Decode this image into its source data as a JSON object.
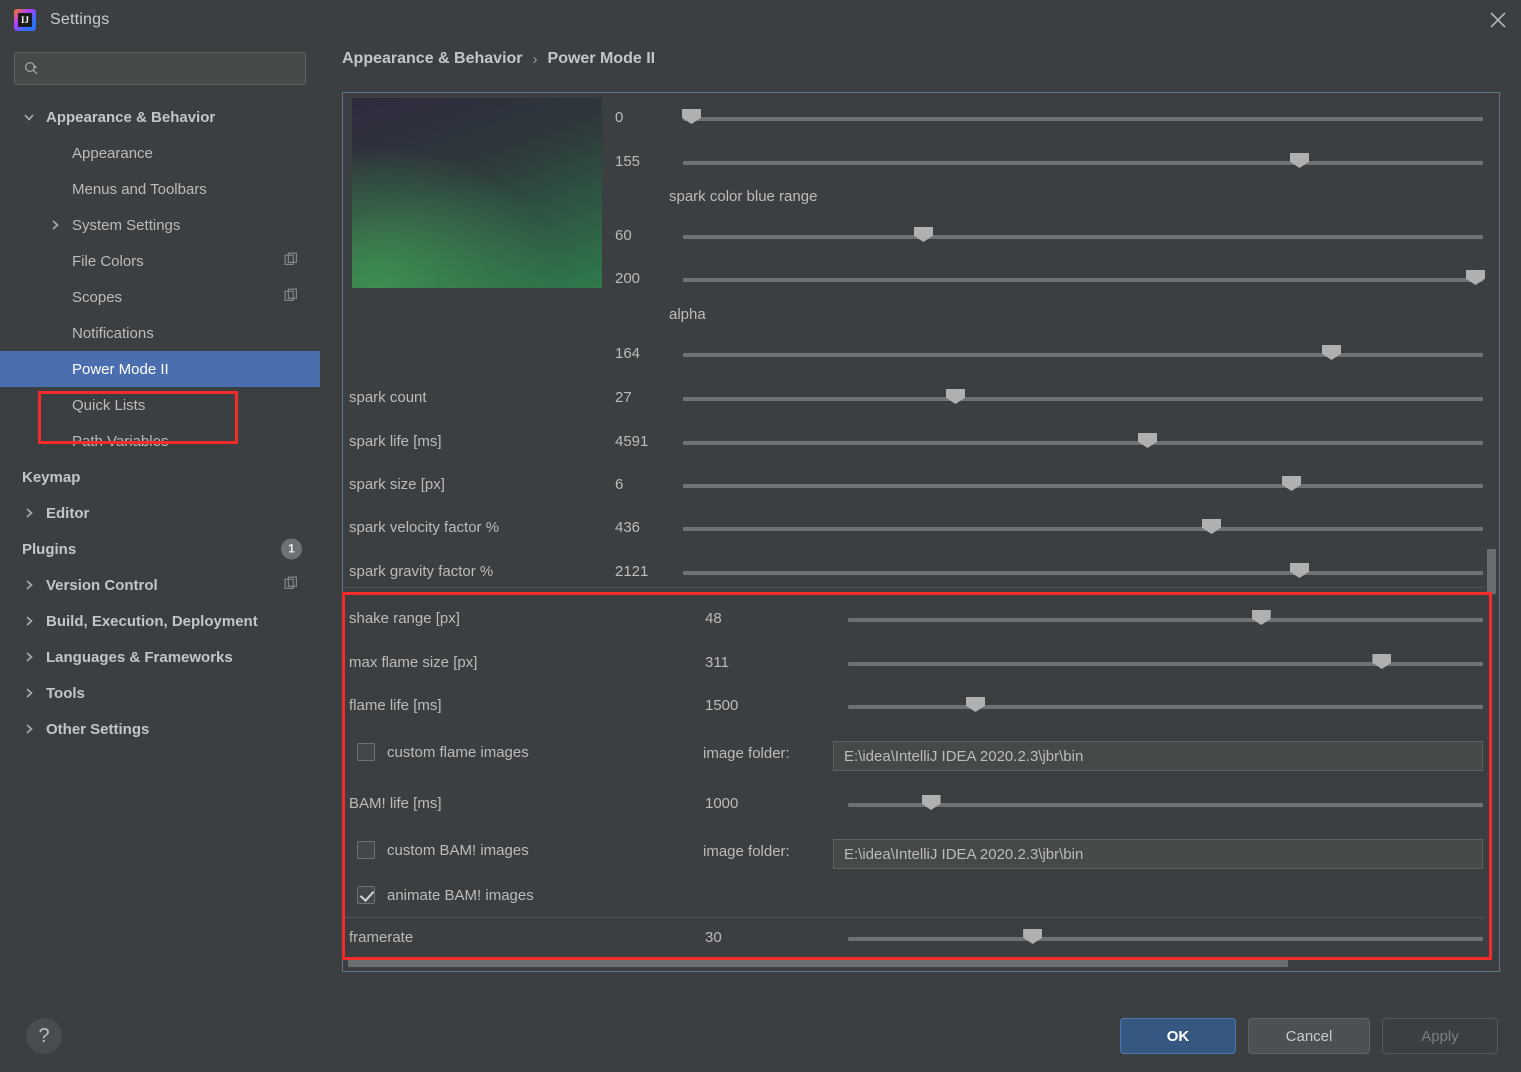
{
  "window": {
    "title": "Settings",
    "app_icon": "intellij-idea-icon",
    "close_icon": "close-icon"
  },
  "search": {
    "value": "",
    "placeholder": "",
    "icon": "search-icon"
  },
  "sidebar": {
    "items": [
      {
        "label": "Appearance & Behavior",
        "level": 0,
        "arrow": "chevron-down",
        "selected": false
      },
      {
        "label": "Appearance",
        "level": 1,
        "arrow": "",
        "selected": false
      },
      {
        "label": "Menus and Toolbars",
        "level": 1,
        "arrow": "",
        "selected": false
      },
      {
        "label": "System Settings",
        "level": 1,
        "arrow": "chevron-right",
        "selected": false
      },
      {
        "label": "File Colors",
        "level": 1,
        "arrow": "",
        "selected": false,
        "trailing": "copy-icon"
      },
      {
        "label": "Scopes",
        "level": 1,
        "arrow": "",
        "selected": false,
        "trailing": "copy-icon"
      },
      {
        "label": "Notifications",
        "level": 1,
        "arrow": "",
        "selected": false
      },
      {
        "label": "Power Mode II",
        "level": 1,
        "arrow": "",
        "selected": true
      },
      {
        "label": "Quick Lists",
        "level": 1,
        "arrow": "",
        "selected": false
      },
      {
        "label": "Path Variables",
        "level": 1,
        "arrow": "",
        "selected": false
      },
      {
        "label": "Keymap",
        "level": 0,
        "arrow": "",
        "selected": false
      },
      {
        "label": "Editor",
        "level": 0,
        "arrow": "chevron-right",
        "selected": false
      },
      {
        "label": "Plugins",
        "level": 0,
        "arrow": "",
        "selected": false,
        "badge": "1"
      },
      {
        "label": "Version Control",
        "level": 0,
        "arrow": "chevron-right",
        "selected": false,
        "trailing": "copy-icon"
      },
      {
        "label": "Build, Execution, Deployment",
        "level": 0,
        "arrow": "chevron-right",
        "selected": false
      },
      {
        "label": "Languages & Frameworks",
        "level": 0,
        "arrow": "chevron-right",
        "selected": false
      },
      {
        "label": "Tools",
        "level": 0,
        "arrow": "chevron-right",
        "selected": false
      },
      {
        "label": "Other Settings",
        "level": 0,
        "arrow": "chevron-right",
        "selected": false
      }
    ]
  },
  "breadcrumb": {
    "root": "Appearance & Behavior",
    "separator": "›",
    "current": "Power Mode II"
  },
  "panel": {
    "preview_alt": "spark-color-gradient-preview",
    "standalone_labels": {
      "spark_color_blue_range": "spark color blue range",
      "alpha": "alpha"
    },
    "sliders": [
      {
        "label": "",
        "value": "0",
        "pos_pct": 1
      },
      {
        "label": "",
        "value": "155",
        "pos_pct": 77
      },
      {
        "label": "",
        "value": "60",
        "pos_pct": 30
      },
      {
        "label": "",
        "value": "200",
        "pos_pct": 99
      },
      {
        "label": "",
        "value": "164",
        "pos_pct": 81
      },
      {
        "label": "spark count",
        "value": "27",
        "pos_pct": 34
      },
      {
        "label": "spark life [ms]",
        "value": "4591",
        "pos_pct": 58
      },
      {
        "label": "spark size [px]",
        "value": "6",
        "pos_pct": 76
      },
      {
        "label": "spark velocity factor %",
        "value": "436",
        "pos_pct": 66
      },
      {
        "label": "spark gravity factor %",
        "value": "2121",
        "pos_pct": 77
      }
    ],
    "lower_sliders": [
      {
        "label": "shake range [px]",
        "value": "48",
        "pos_pct": 65
      },
      {
        "label": "max flame size [px]",
        "value": "311",
        "pos_pct": 84
      },
      {
        "label": "flame life [ms]",
        "value": "1500",
        "pos_pct": 20
      },
      {
        "label": "BAM! life [ms]",
        "value": "1000",
        "pos_pct": 13
      },
      {
        "label": "framerate",
        "value": "30",
        "pos_pct": 29
      }
    ],
    "checkboxes": [
      {
        "label": "custom flame images",
        "checked": false
      },
      {
        "label": "custom BAM! images",
        "checked": false
      },
      {
        "label": "animate BAM! images",
        "checked": true
      }
    ],
    "folder_label": "image folder:",
    "folder_paths": [
      "E:\\idea\\IntelliJ IDEA 2020.2.3\\jbr\\bin",
      "E:\\idea\\IntelliJ IDEA 2020.2.3\\jbr\\bin"
    ]
  },
  "footer": {
    "help": "?",
    "ok": "OK",
    "cancel": "Cancel",
    "apply": "Apply"
  },
  "colors": {
    "background": "#3c3f41",
    "selection": "#4b6eaf",
    "highlight_marker": "#f42b2b",
    "ok_button": "#365880",
    "slider_track": "#6f7274",
    "slider_thumb": "#aeb0b2"
  }
}
